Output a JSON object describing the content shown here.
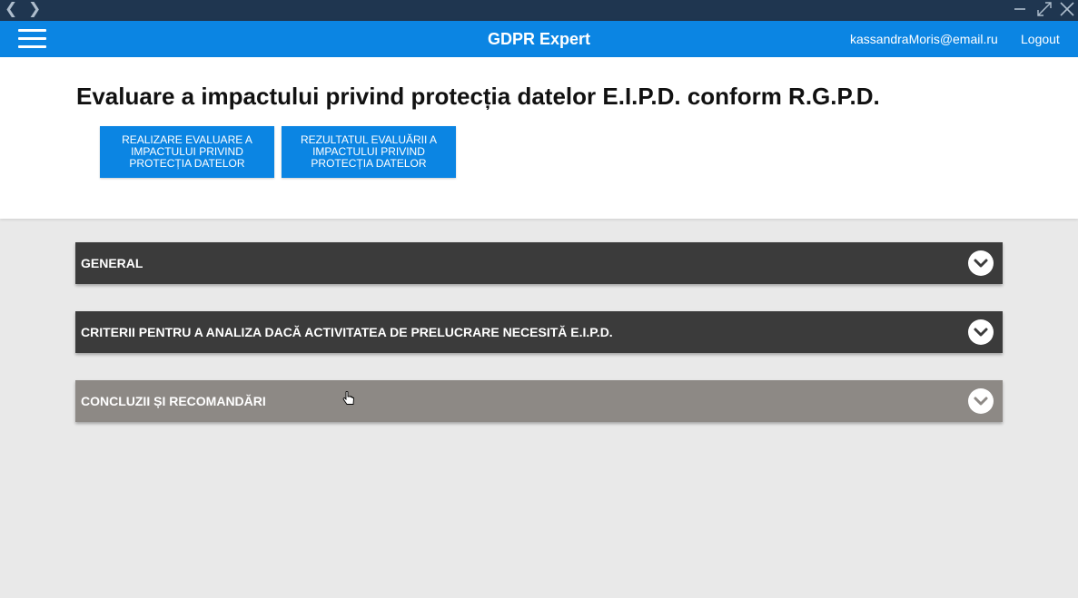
{
  "window": {
    "back_icon": "chevron-left-icon",
    "forward_icon": "chevron-right-icon",
    "minimize_icon": "minimize-icon",
    "maximize_icon": "expand-icon",
    "close_icon": "close-icon"
  },
  "appbar": {
    "title": "GDPR Expert",
    "user_email": "kassandraMoris@email.ru",
    "logout_label": "Logout",
    "menu_icon": "hamburger-menu-icon",
    "color": "#0b85e3"
  },
  "page": {
    "title": "Evaluare a impactului privind protecția datelor E.I.P.D. conform R.G.P.D.",
    "buttons": [
      {
        "label": "REALIZARE EVALUARE A IMPACTULUI PRIVIND PROTECȚIA DATELOR"
      },
      {
        "label": "REZULTATUL EVALUĂRII A IMPACTULUI PRIVIND PROTECȚIA DATELOR"
      }
    ]
  },
  "sections": [
    {
      "label": "GENERAL",
      "icon": "chevron-down-icon",
      "color": "#3b3b3b"
    },
    {
      "label": "CRITERII PENTRU A ANALIZA DACĂ ACTIVITATEA DE PRELUCRARE NECESITĂ E.I.P.D.",
      "icon": "chevron-down-icon",
      "color": "#3b3b3b"
    },
    {
      "label": "CONCLUZII ȘI RECOMANDĂRI",
      "icon": "chevron-down-icon",
      "color": "#8d8985"
    }
  ]
}
